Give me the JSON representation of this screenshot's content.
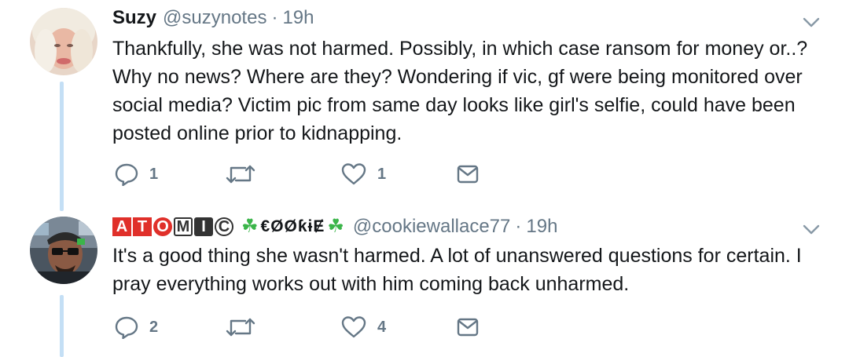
{
  "tweets": [
    {
      "name": "Suzy",
      "handle": "@suzynotes",
      "separator": "·",
      "time": "19h",
      "text": "Thankfully, she was not harmed. Possibly, in which case ransom for money or..? Why no news? Where are they? Wondering if vic, gf were being monitored over social media? Victim pic from same day looks like girl's selfie, could have been posted online prior to kidnapping.",
      "replies": "1",
      "retweets": "",
      "likes": "1"
    },
    {
      "name_badges": [
        "A",
        "T",
        "O",
        "M",
        "I",
        "C"
      ],
      "name_shamrock": "☘",
      "name_fancy": "€ØØƙɨɆ",
      "handle": "@cookiewallace77",
      "separator": "·",
      "time": "19h",
      "text": "It's a good thing she wasn't harmed. A lot of unanswered questions for certain. I pray everything works out with him coming back unharmed.",
      "replies": "2",
      "retweets": "",
      "likes": "4"
    }
  ],
  "icons": {
    "reply": "reply-icon",
    "retweet": "retweet-icon",
    "like": "heart-icon",
    "message": "envelope-icon",
    "caret": "chevron-down-icon"
  },
  "colors": {
    "thread_line": "#c4dff5",
    "secondary_text": "#657786",
    "badge_red": "#e0302a",
    "shamrock": "#3bb54a"
  }
}
